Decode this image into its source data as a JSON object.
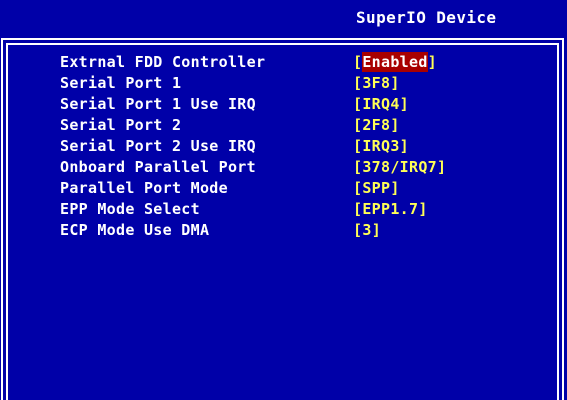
{
  "header": {
    "title": "SuperIO Device"
  },
  "colors": {
    "background": "#0000a8",
    "label": "#ffffff",
    "value": "#ffff55",
    "highlight_bg": "#a80000",
    "highlight_text": "#ffffff"
  },
  "settings": [
    {
      "label": "Extrnal FDD Controller",
      "value": "Enabled",
      "selected": true
    },
    {
      "label": "Serial Port 1",
      "value": "3F8",
      "selected": false
    },
    {
      "label": "Serial Port 1 Use IRQ",
      "value": "IRQ4",
      "selected": false
    },
    {
      "label": "Serial Port 2",
      "value": "2F8",
      "selected": false
    },
    {
      "label": "Serial Port 2 Use IRQ",
      "value": "IRQ3",
      "selected": false
    },
    {
      "label": "Onboard Parallel Port",
      "value": "378/IRQ7",
      "selected": false
    },
    {
      "label": "Parallel Port Mode",
      "value": "SPP",
      "selected": false
    },
    {
      "label": "EPP Mode Select",
      "value": "EPP1.7",
      "selected": false
    },
    {
      "label": "ECP Mode Use DMA",
      "value": "3",
      "selected": false
    }
  ]
}
